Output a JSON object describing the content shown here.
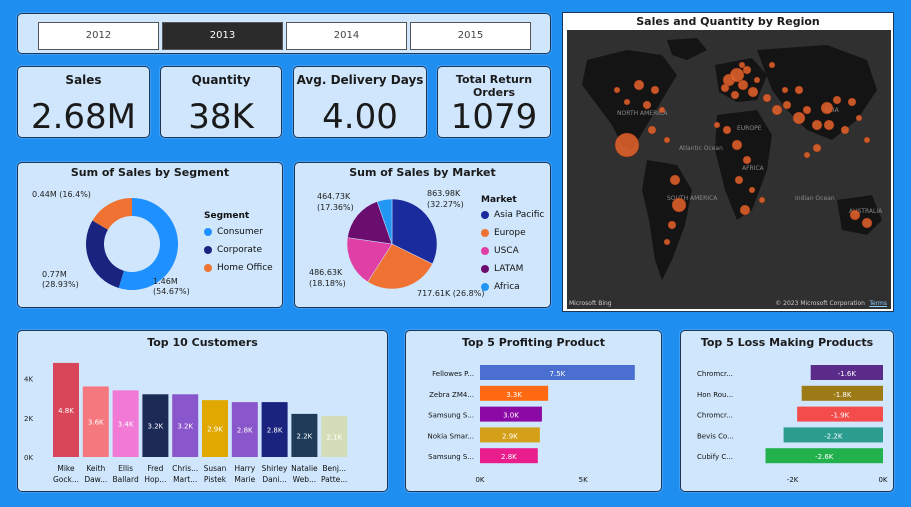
{
  "years": {
    "items": [
      "2012",
      "2013",
      "2014",
      "2015"
    ],
    "selected": "2013"
  },
  "kpis": [
    {
      "label": "Sales",
      "value": "2.68M"
    },
    {
      "label": "Quantity",
      "value": "38K"
    },
    {
      "label": "Avg. Delivery Days",
      "value": "4.00"
    },
    {
      "label": "Total Return Orders",
      "value": "1079"
    }
  ],
  "map": {
    "title": "Sales and Quantity by Region",
    "labels": [
      "NORTH AMERICA",
      "SOUTH AMERICA",
      "EUROPE",
      "AFRICA",
      "ASIA",
      "AUSTRALIA",
      "Atlantic Ocean",
      "Indian Ocean"
    ],
    "attribution": "© 2023 Microsoft Corporation",
    "terms": "Terms",
    "brand": "Microsoft Bing"
  },
  "colors": {
    "consumer": "#1e90ff",
    "corporate": "#1a237e",
    "home_office": "#f07232",
    "asia_pacific": "#1a2b9e",
    "europe": "#f07232",
    "usca": "#e040a6",
    "latam": "#6a0d6e",
    "africa": "#2196f3"
  },
  "chart_data": [
    {
      "type": "pie",
      "title": "Sum of Sales by Segment",
      "legend_title": "Segment",
      "categories": [
        "Consumer",
        "Corporate",
        "Home Office"
      ],
      "values": [
        1.46,
        0.77,
        0.44
      ],
      "data_labels": [
        "1.46M (54.67%)",
        "0.77M (28.93%)",
        "0.44M (16.4%)"
      ],
      "donut": true,
      "legend_position": "right"
    },
    {
      "type": "pie",
      "title": "Sum of Sales by Market",
      "legend_title": "Market",
      "categories": [
        "Asia Pacific",
        "Europe",
        "USCA",
        "LATAM",
        "Africa"
      ],
      "values": [
        863.98,
        717.61,
        486.63,
        464.73,
        143.5
      ],
      "data_labels": [
        "863.98K (32.27%)",
        "717.61K (26.8%)",
        "486.63K (18.18%)",
        "464.73K (17.36%)",
        ""
      ],
      "legend_position": "right"
    },
    {
      "type": "bar",
      "title": "Top 10 Customers",
      "categories": [
        "Mike Gock...",
        "Keith Daw...",
        "Ellis Ballard",
        "Fred Hop...",
        "Chris... Mart...",
        "Susan Pistek",
        "Harry Marie",
        "Shirley Dani...",
        "Natalie Web...",
        "Benj... Patte..."
      ],
      "values": [
        4.8,
        3.6,
        3.4,
        3.2,
        3.2,
        2.9,
        2.8,
        2.8,
        2.2,
        2.1
      ],
      "data_labels": [
        "4.8K",
        "3.6K",
        "3.4K",
        "3.2K",
        "3.2K",
        "2.9K",
        "2.8K",
        "2.8K",
        "2.2K",
        "2.1K"
      ],
      "colors": [
        "#d9465a",
        "#f6787f",
        "#f07ad6",
        "#1c2a56",
        "#8a56cc",
        "#e0a800",
        "#8a56cc",
        "#1a237e",
        "#1f3b5a",
        "#d5ddb8"
      ],
      "yticks": [
        "0K",
        "2K",
        "4K"
      ],
      "ylim": [
        0,
        5
      ]
    },
    {
      "type": "bar",
      "orientation": "horizontal",
      "title": "Top 5 Profiting Product",
      "categories": [
        "Fellowes P...",
        "Zebra ZM4...",
        "Samsung S...",
        "Nokia Smar...",
        "Samsung S..."
      ],
      "values": [
        7.5,
        3.3,
        3.0,
        2.9,
        2.8
      ],
      "data_labels": [
        "7.5K",
        "3.3K",
        "3.0K",
        "2.9K",
        "2.8K"
      ],
      "colors": [
        "#4a6fd1",
        "#ff6a13",
        "#8b0aa5",
        "#d4a017",
        "#e91e8c"
      ],
      "xticks": [
        "0K",
        "5K"
      ],
      "xlim": [
        0,
        7.8
      ]
    },
    {
      "type": "bar",
      "orientation": "horizontal",
      "title": "Top 5 Loss Making Products",
      "categories": [
        "Chromcr...",
        "Hon Rou...",
        "Chromcr...",
        "Bevis Co...",
        "Cubify C..."
      ],
      "values": [
        -1.6,
        -1.8,
        -1.9,
        -2.2,
        -2.6
      ],
      "data_labels": [
        "-1.6K",
        "-1.8K",
        "-1.9K",
        "-2.2K",
        "-2.6K"
      ],
      "colors": [
        "#5b2b8a",
        "#9c7a16",
        "#f44b4b",
        "#2a9d8f",
        "#22b14c"
      ],
      "xticks": [
        "-2K",
        "0K"
      ],
      "xlim": [
        -2.7,
        0
      ]
    }
  ]
}
